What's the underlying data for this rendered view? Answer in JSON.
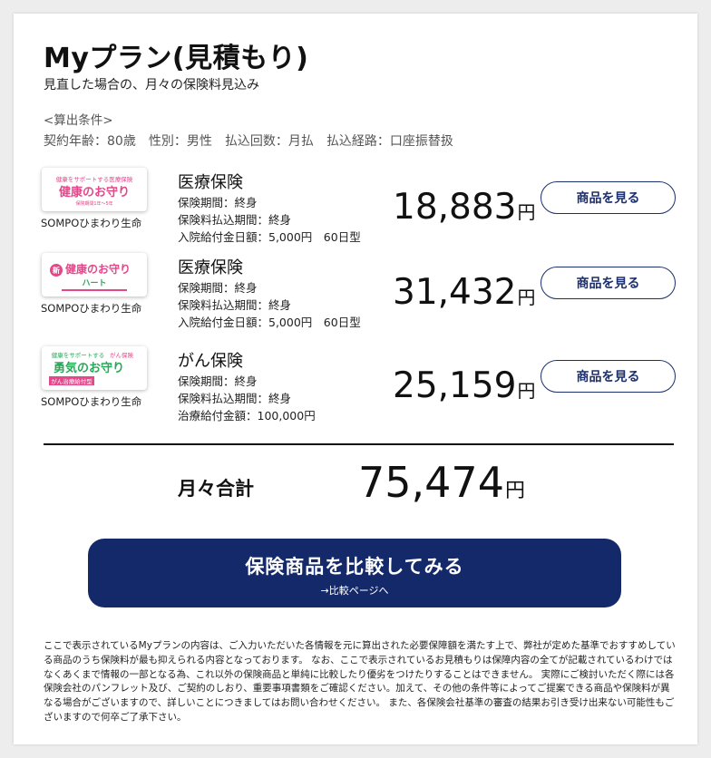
{
  "header": {
    "title": "Myプラン(見積もり)",
    "subtitle": "見直した場合の、月々の保険料見込み"
  },
  "conditions": {
    "heading": "<算出条件>",
    "line": "契約年齢：80歳　性別：男性　払込回数：月払　払込経路：口座振替扱"
  },
  "products": [
    {
      "logo_lines": [
        "健康をサポートする医療保険",
        "健康のお守り",
        "保険期間1年〜5年"
      ],
      "company": "SOMPOひまわり生命",
      "name": "医療保険",
      "details": [
        "保険期間：終身",
        "保険料払込期間：終身",
        "入院給付金日額：5,000円　60日型"
      ],
      "price": "18,883",
      "yen": "円",
      "button": "商品を見る"
    },
    {
      "logo_lines": [
        "新",
        "健康のお守り",
        "ハート"
      ],
      "company": "SOMPOひまわり生命",
      "name": "医療保険",
      "details": [
        "保険期間：終身",
        "保険料払込期間：終身",
        "入院給付金日額：5,000円　60日型"
      ],
      "price": "31,432",
      "yen": "円",
      "button": "商品を見る"
    },
    {
      "logo_lines": [
        "健康をサポートする",
        "がん保険",
        "勇気のお守り",
        "がん治療給付型"
      ],
      "company": "SOMPOひまわり生命",
      "name": "がん保険",
      "details": [
        "保険期間：終身",
        "保険料払込期間：終身",
        "治療給付金額：100,000円"
      ],
      "price": "25,159",
      "yen": "円",
      "button": "商品を見る"
    }
  ],
  "total": {
    "label": "月々合計",
    "value": "75,474",
    "yen": "円"
  },
  "compare_button": {
    "label": "保険商品を比較してみる",
    "sub": "→比較ページへ"
  },
  "disclaimer": "ここで表示されているMyプランの内容は、ご入力いただいた各情報を元に算出された必要保障額を満たす上で、弊社が定めた基準でおすすめしている商品のうち保険料が最も抑えられる内容となっております。 なお、ここで表示されているお見積もりは保障内容の全てが記載されているわけではなくあくまで情報の一部となる為、これ以外の保険商品と単純に比較したり優劣をつけたりすることはできません。 実際にご検討いただく際には各保険会社のパンフレット及び、ご契約のしおり、重要事項書類をご確認ください。加えて、その他の条件等によってご提案できる商品や保険料が異なる場合がございますので、詳しいことにつきましてはお問い合わせください。 また、各保険会社基準の審査の結果お引き受け出来ない可能性もございますので何卒ご了承下さい。",
  "colors": {
    "accent_navy": "#14296a",
    "logo_pink": "#e4478a",
    "logo_green": "#2aa85a"
  }
}
